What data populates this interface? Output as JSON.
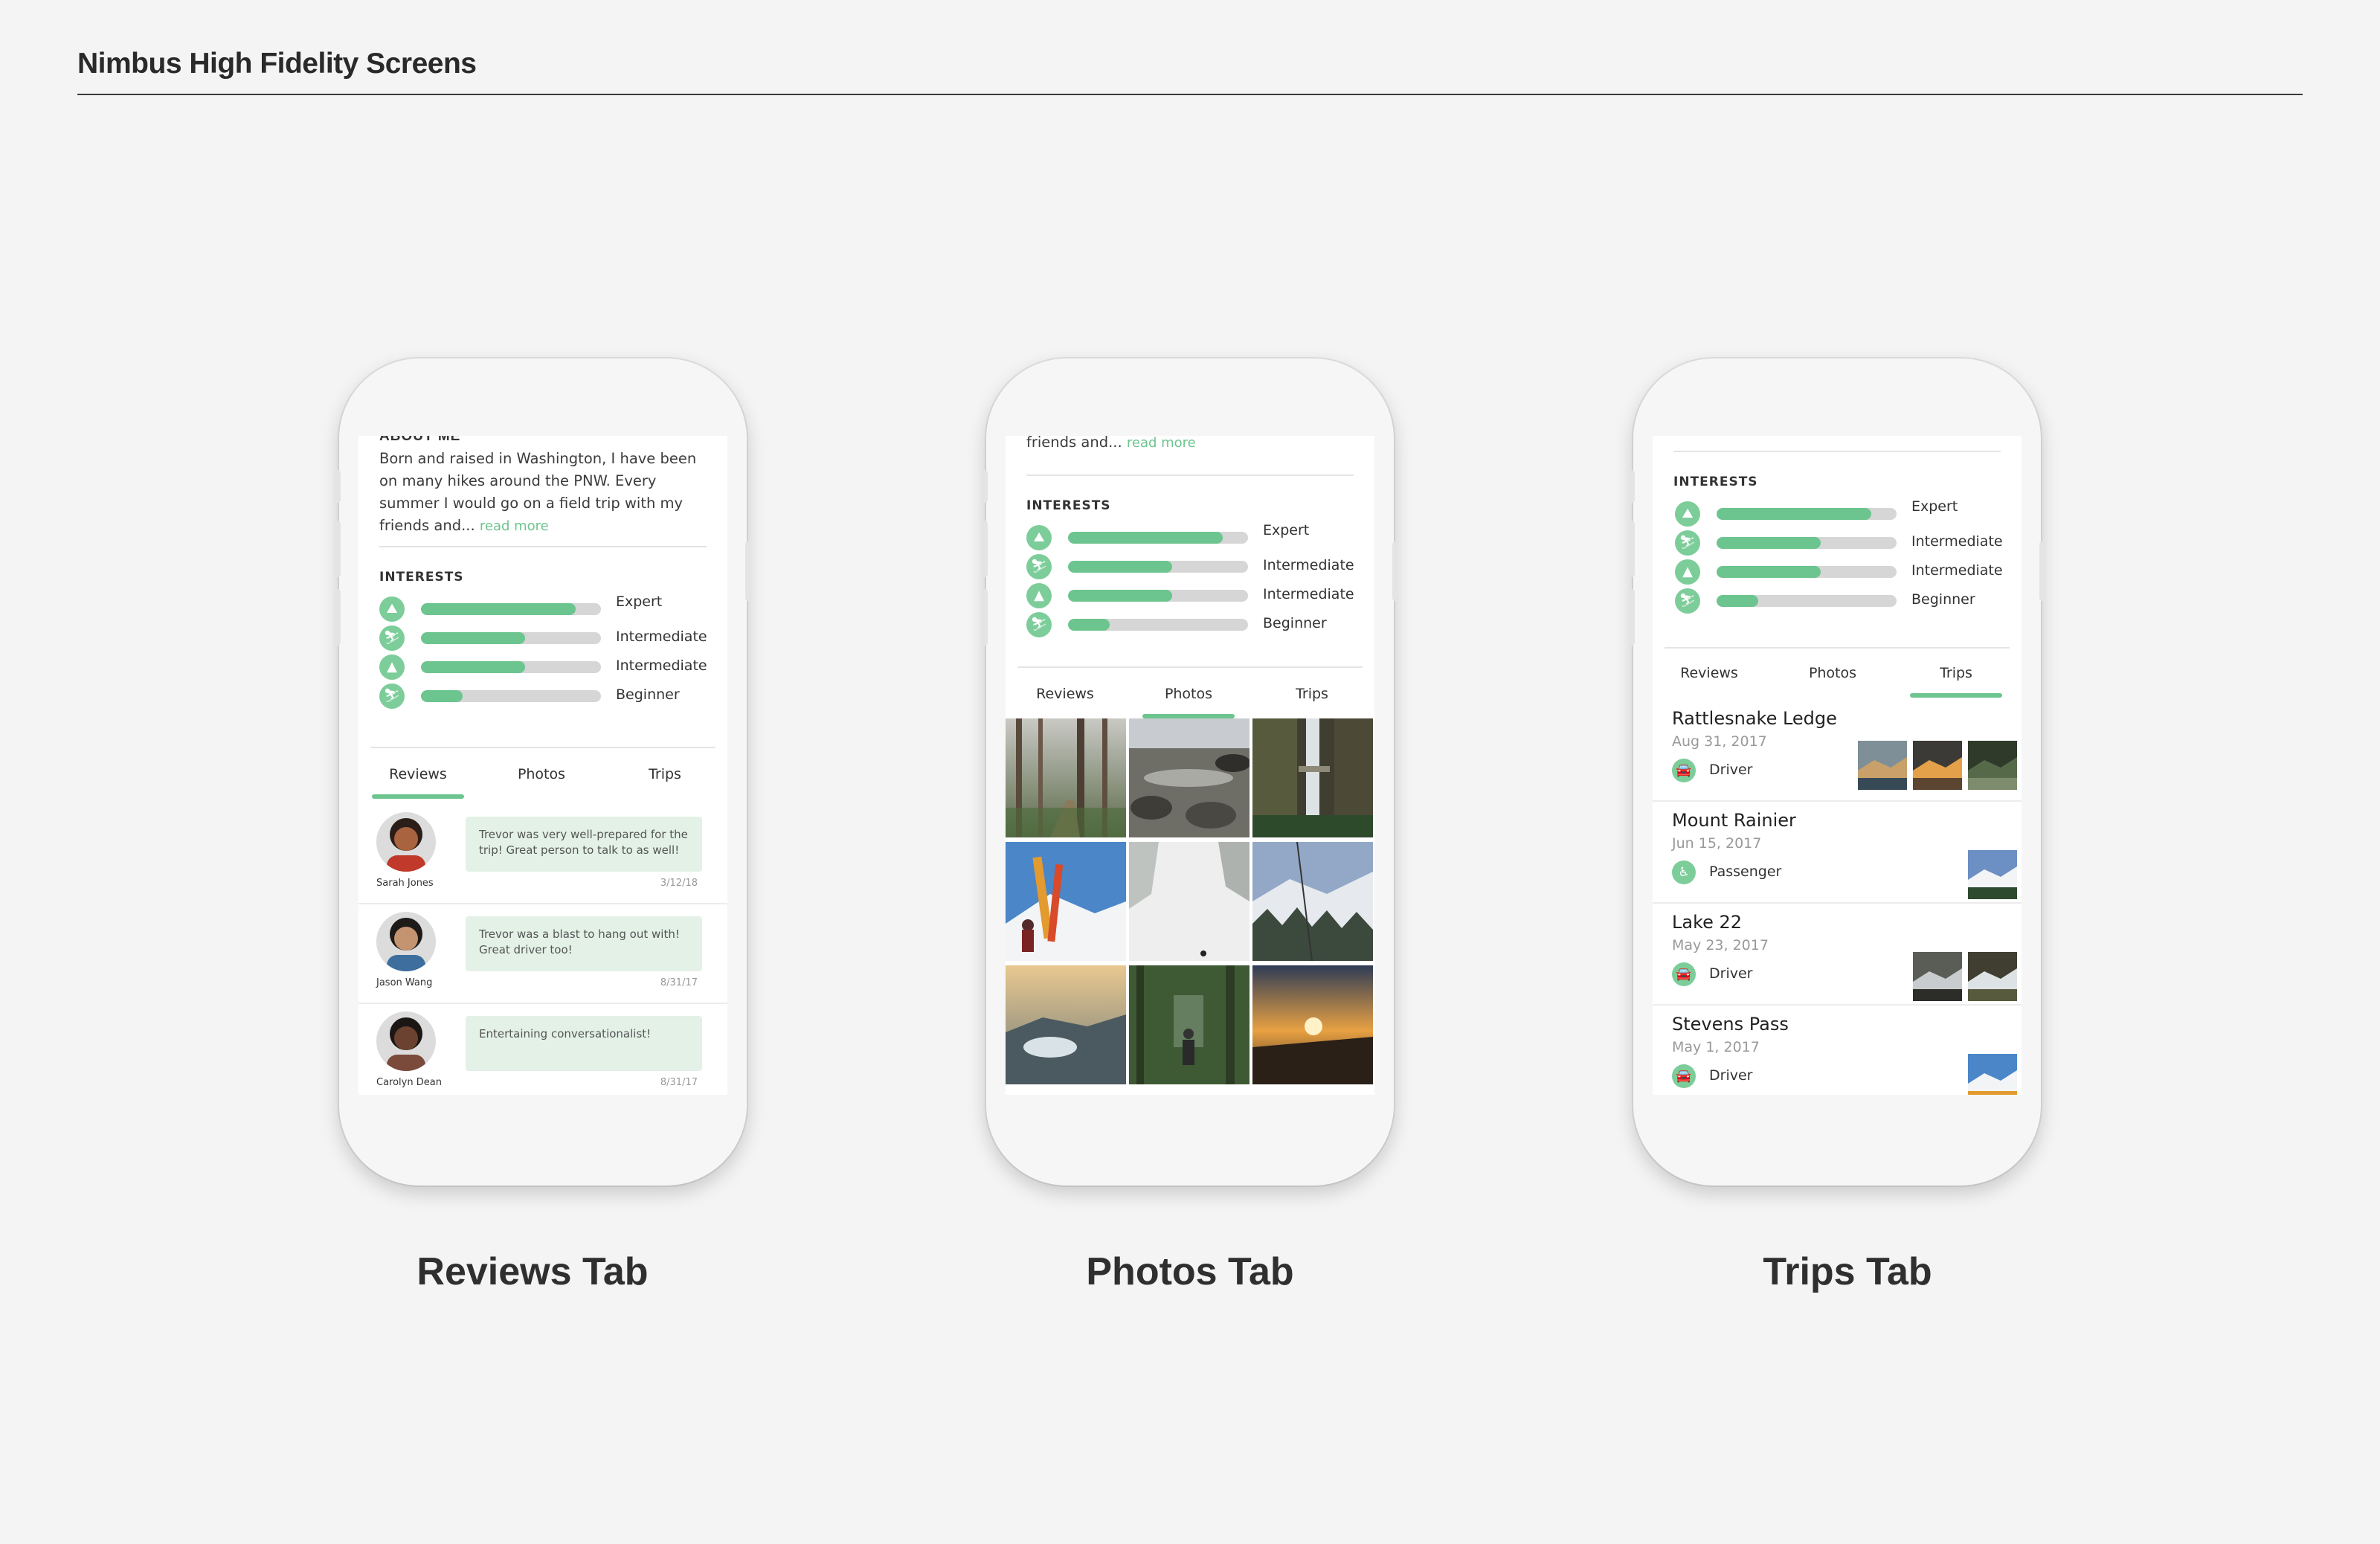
{
  "page": {
    "title": "Nimbus High Fidelity Screens"
  },
  "captions": [
    "Reviews Tab",
    "Photos Tab",
    "Trips Tab"
  ],
  "profile": {
    "about_heading": "ABOUT ME",
    "about_text": "Born and raised in Washington, I have been on many hikes around the PNW. Every summer I would go on a field trip with my friends and... ",
    "about_tail": "friends and... ",
    "read_more": "read more",
    "interests_heading": "INTERESTS",
    "interests": [
      {
        "icon": "hiking-icon",
        "glyph": "⛰",
        "level": "Expert",
        "progress": 0.86
      },
      {
        "icon": "skiing-icon",
        "glyph": "⛷",
        "level": "Intermediate",
        "progress": 0.58
      },
      {
        "icon": "climbing-icon",
        "glyph": "▲",
        "level": "Intermediate",
        "progress": 0.58
      },
      {
        "icon": "snowboard-icon",
        "glyph": "⛷",
        "level": "Beginner",
        "progress": 0.23
      }
    ],
    "tabs": [
      "Reviews",
      "Photos",
      "Trips"
    ]
  },
  "reviews": [
    {
      "name": "Sarah Jones",
      "text": "Trevor was very well-prepared for the trip! Great person to talk to as well!",
      "date": "3/12/18"
    },
    {
      "name": "Jason Wang",
      "text": "Trevor was a blast to hang out with! Great driver too!",
      "date": "8/31/17"
    },
    {
      "name": "Carolyn Dean",
      "text": "Entertaining conversationalist!",
      "date": "8/31/17"
    }
  ],
  "trips": [
    {
      "name": "Rattlesnake Ledge",
      "date": "Aug 31, 2017",
      "role": "Driver",
      "role_icon": "car-icon"
    },
    {
      "name": "Mount Rainier",
      "date": "Jun 15, 2017",
      "role": "Passenger",
      "role_icon": "passenger-icon"
    },
    {
      "name": "Lake 22",
      "date": "May 23, 2017",
      "role": "Driver",
      "role_icon": "car-icon"
    },
    {
      "name": "Stevens Pass",
      "date": "May 1, 2017",
      "role": "Driver",
      "role_icon": "car-icon"
    }
  ],
  "colors": {
    "accent": "#6cc58e",
    "bubble": "#e3f1e7",
    "track": "#d6d6d6"
  }
}
